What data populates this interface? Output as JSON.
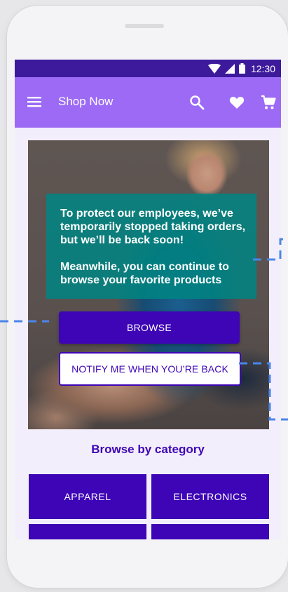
{
  "status_bar": {
    "time": "12:30"
  },
  "app_bar": {
    "title": "Shop Now",
    "actions": [
      "menu-icon",
      "search-icon",
      "heart-icon",
      "cart-icon"
    ]
  },
  "hero": {
    "message_line_1": "To protect our employees, we’ve temporarily stopped taking orders, but we’ll be back soon!",
    "message_line_2": "Meanwhile, you can continue to browse your favorite products",
    "browse_label": "BROWSE",
    "notify_label": "NOTIFY ME WHEN YOU’RE BACK"
  },
  "categories": {
    "title": "Browse by category",
    "items": [
      {
        "label": "APPAREL"
      },
      {
        "label": "ELECTRONICS"
      },
      {
        "label": ""
      },
      {
        "label": ""
      }
    ]
  },
  "colors": {
    "status_bar": "#3d1a9c",
    "app_bar": "#9c6af5",
    "primary": "#3d05b5",
    "overlay": "#008582",
    "screen_bg": "#f3eefb",
    "callout": "#4a86e8"
  }
}
